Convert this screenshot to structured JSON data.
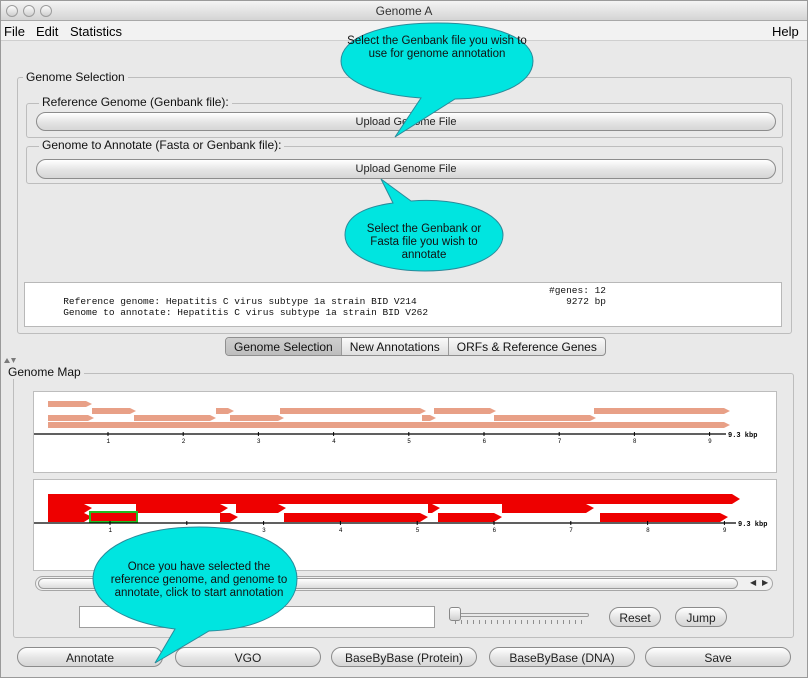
{
  "window": {
    "title": "Genome A",
    "traffic_lights": [
      "close",
      "minimize",
      "zoom"
    ]
  },
  "menubar": {
    "items": [
      "File",
      "Edit",
      "Statistics"
    ],
    "help": "Help"
  },
  "genome_selection": {
    "legend": "Genome Selection",
    "reference": {
      "legend": "Reference Genome (Genbank file):",
      "button": "Upload Genome File"
    },
    "target": {
      "legend": "Genome to Annotate (Fasta or Genbank file):",
      "button": "Upload Genome File"
    },
    "log": [
      {
        "left": "Reference genome: Hepatitis C virus subtype 1a strain BID V214",
        "right": "#genes: 12"
      },
      {
        "left": "Genome to annotate: Hepatitis C virus subtype 1a strain BID V262",
        "right": "   9272 bp"
      }
    ]
  },
  "tabs": [
    {
      "label": "Genome Selection",
      "selected": true
    },
    {
      "label": "New Annotations",
      "selected": false
    },
    {
      "label": "ORFs & Reference Genes",
      "selected": false
    }
  ],
  "genome_map": {
    "legend": "Genome Map",
    "ticks": [
      "1",
      "2",
      "3",
      "4",
      "5",
      "6",
      "7",
      "8",
      "9"
    ],
    "end_label": "9.3 kbp",
    "colors": {
      "reference": "#e8a087",
      "annotated": "#ee0000",
      "highlight": "#22bb22"
    }
  },
  "controls": {
    "text_value": "",
    "reset": "Reset",
    "jump": "Jump"
  },
  "bottom_buttons": {
    "annotate": "Annotate",
    "vgo": "VGO",
    "bbb_protein": "BaseByBase (Protein)",
    "bbb_dna": "BaseByBase (DNA)",
    "save": "Save"
  },
  "callouts": {
    "reference": "Select the Genbank file you wish to use for genome annotation",
    "target": "Select the Genbank or Fasta file you wish to annotate",
    "annotate": "Once you have selected the reference genome, and genome to annotate, click to start annotation",
    "color": "#00e5e0"
  }
}
